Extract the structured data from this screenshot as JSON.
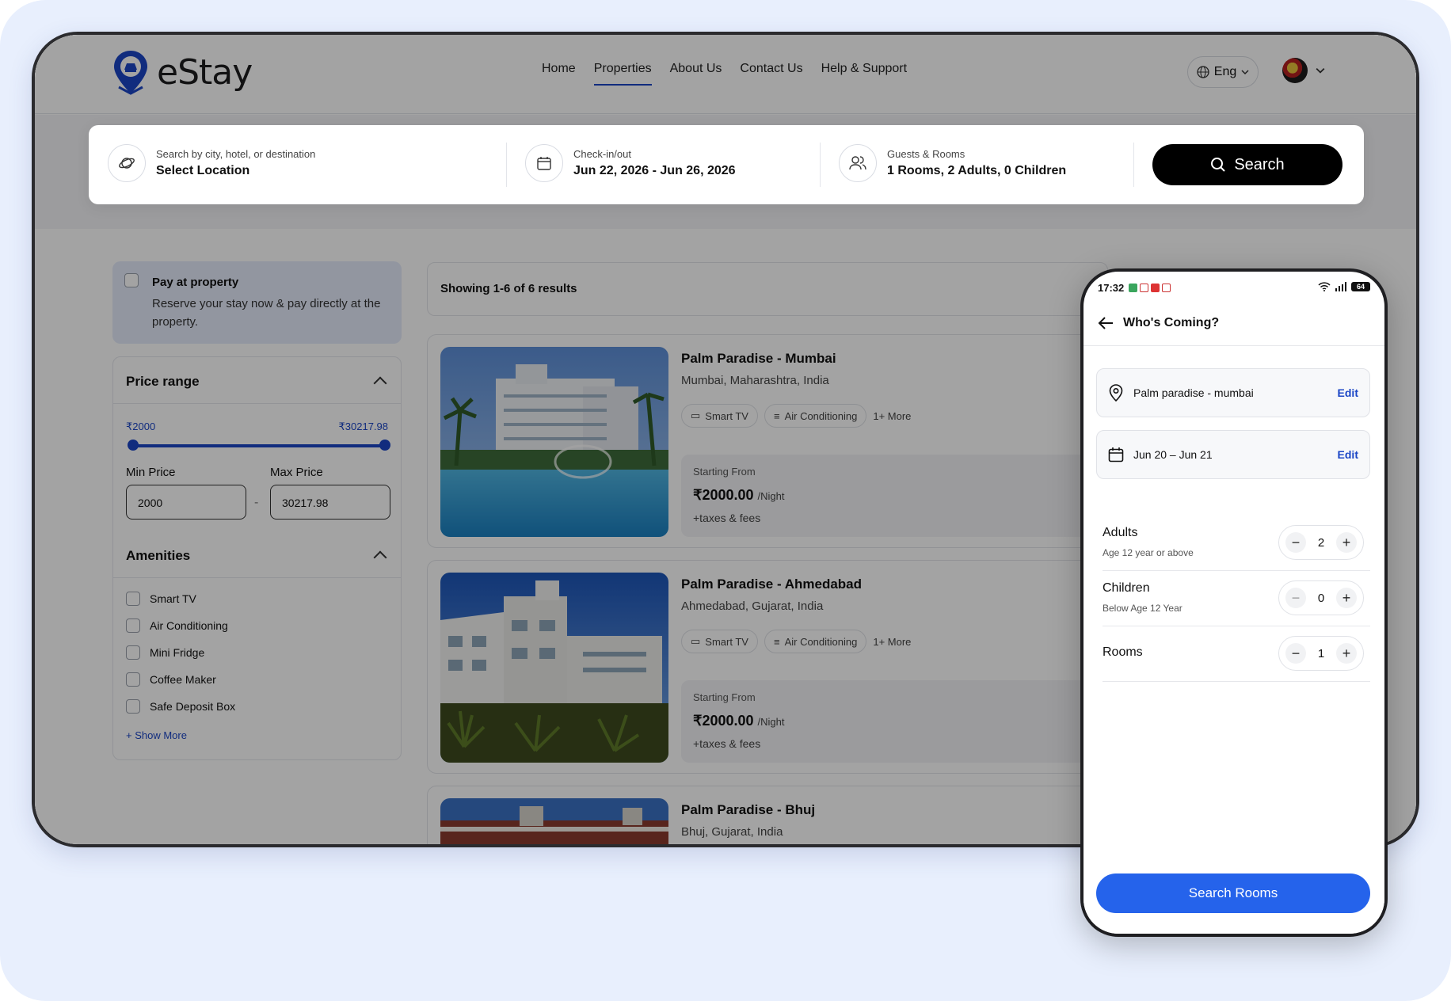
{
  "app": {
    "brand": "eStay"
  },
  "nav": {
    "items": [
      "Home",
      "Properties",
      "About Us",
      "Contact Us",
      "Help & Support"
    ],
    "active": "Properties"
  },
  "lang": {
    "label": "Eng"
  },
  "search": {
    "location_label": "Search by city, hotel, or destination",
    "location_value": "Select Location",
    "dates_label": "Check-in/out",
    "dates_value": "Jun 22, 2026 - Jun 26, 2026",
    "guests_label": "Guests & Rooms",
    "guests_value": "1 Rooms, 2 Adults, 0 Children",
    "button": "Search"
  },
  "sidebar": {
    "pay": {
      "title": "Pay at property",
      "desc": "Reserve your stay now & pay directly at the property."
    },
    "price": {
      "title": "Price range",
      "min_display": "₹2000",
      "max_display": "₹30217.98",
      "min_label": "Min Price",
      "max_label": "Max Price",
      "min_value": "2000",
      "max_value": "30217.98",
      "sep": "-"
    },
    "amenities": {
      "title": "Amenities",
      "items": [
        "Smart TV",
        "Air Conditioning",
        "Mini Fridge",
        "Coffee Maker",
        "Safe Deposit Box"
      ],
      "show_more": "+ Show More"
    }
  },
  "results": {
    "summary": "Showing 1-6 of 6 results",
    "cards": [
      {
        "title": "Palm Paradise - Mumbai",
        "location": "Mumbai, Maharashtra, India",
        "tags": [
          "Smart TV",
          "Air Conditioning"
        ],
        "more": "1+ More",
        "from": "Starting From",
        "price": "₹2000.00",
        "per": "/Night",
        "taxes": "+taxes & fees"
      },
      {
        "title": "Palm Paradise - Ahmedabad",
        "location": "Ahmedabad, Gujarat, India",
        "tags": [
          "Smart TV",
          "Air Conditioning"
        ],
        "more": "1+ More",
        "from": "Starting From",
        "price": "₹2000.00",
        "per": "/Night",
        "taxes": "+taxes & fees"
      },
      {
        "title": "Palm Paradise - Bhuj",
        "location": "Bhuj, Gujarat, India"
      }
    ]
  },
  "phone": {
    "time": "17:32",
    "battery": "64",
    "title": "Who's Coming?",
    "location": "Palm paradise - mumbai",
    "dates": "Jun 20 – Jun 21",
    "edit": "Edit",
    "adults": {
      "label": "Adults",
      "sub": "Age 12 year or above",
      "value": "2"
    },
    "children": {
      "label": "Children",
      "sub": "Below Age 12 Year",
      "value": "0"
    },
    "rooms": {
      "label": "Rooms",
      "value": "1"
    },
    "button": "Search Rooms"
  },
  "colors": {
    "accent": "#1b46c6",
    "button_blue": "#2563eb",
    "background": "#e8effd"
  }
}
